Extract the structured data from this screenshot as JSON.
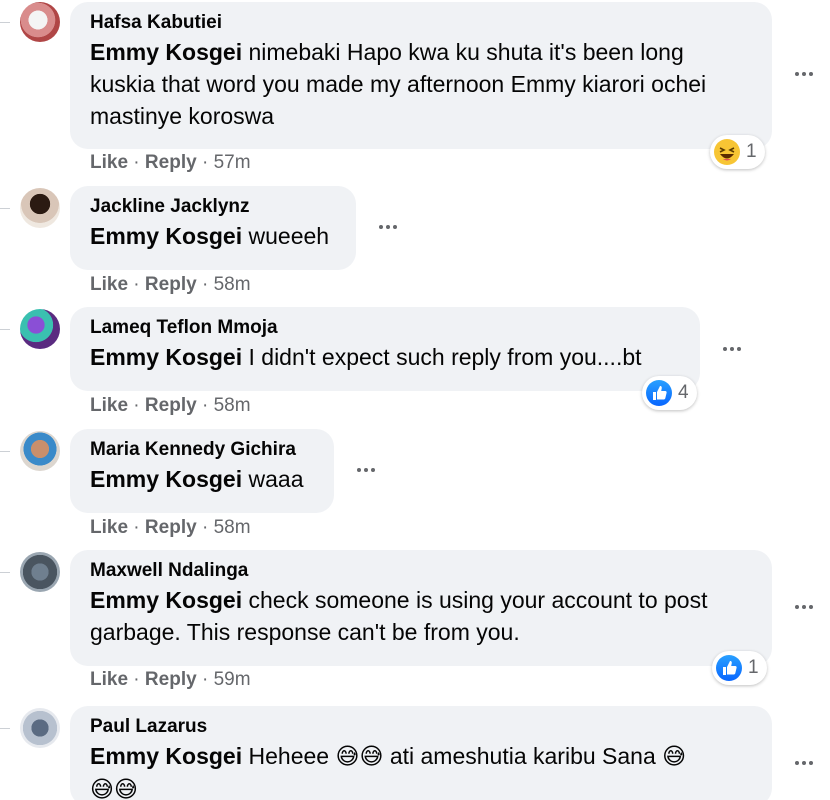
{
  "comments": [
    {
      "author": "Hafsa Kabutiei",
      "mention": "Emmy Kosgei",
      "text": " nimebaki Hapo kwa ku shuta it's been long kuskia that word you made my afternoon Emmy kiarori ochei mastinye koroswa",
      "like_label": "Like",
      "reply_label": "Reply",
      "time": "57m",
      "reaction": {
        "icon": "haha-icon",
        "count": "1"
      }
    },
    {
      "author": "Jackline Jacklynz",
      "mention": "Emmy Kosgei",
      "text": " wueeeh",
      "like_label": "Like",
      "reply_label": "Reply",
      "time": "58m"
    },
    {
      "author": "Lameq Teflon Mmoja",
      "mention": "Emmy Kosgei",
      "text": " I didn't expect such reply from you....bt",
      "like_label": "Like",
      "reply_label": "Reply",
      "time": "58m",
      "reaction": {
        "icon": "like-icon",
        "count": "4"
      }
    },
    {
      "author": "Maria Kennedy Gichira",
      "mention": "Emmy Kosgei",
      "text": " waaa",
      "like_label": "Like",
      "reply_label": "Reply",
      "time": "58m"
    },
    {
      "author": "Maxwell Ndalinga",
      "mention": "Emmy Kosgei",
      "text": " check someone is using your account to post garbage. This response can't be from you.",
      "like_label": "Like",
      "reply_label": "Reply",
      "time": "59m",
      "reaction": {
        "icon": "like-icon",
        "count": "1"
      }
    },
    {
      "author": "Paul Lazarus",
      "mention": "Emmy Kosgei",
      "text_part1": " Heheee ",
      "emoji_a": "😅😅",
      "text_part2": " ati ameshutia karibu Sana ",
      "emoji_b": "😅",
      "emoji_c": "😅😅"
    }
  ],
  "colors": {
    "bubble": "#f0f2f5",
    "secondary_text": "#65676b",
    "like_blue": "#0866ff"
  }
}
